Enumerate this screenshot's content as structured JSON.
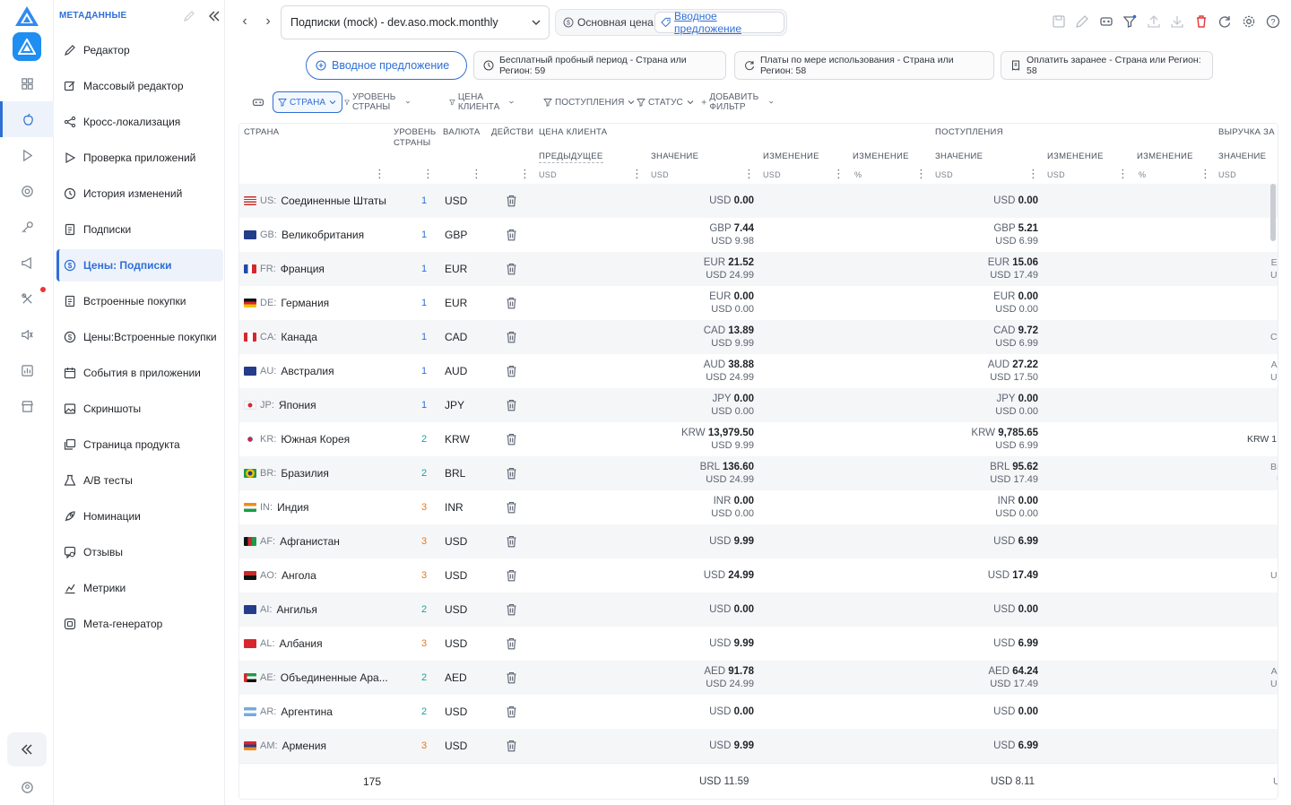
{
  "sidebar": {
    "title": "МЕТАДАННЫЕ",
    "items": [
      {
        "label": "Редактор",
        "icon": "pencil-icon"
      },
      {
        "label": "Массовый редактор",
        "icon": "edit-square-icon"
      },
      {
        "label": "Кросс-локализация",
        "icon": "share-icon"
      },
      {
        "label": "Проверка приложений",
        "icon": "play-icon"
      },
      {
        "label": "История изменений",
        "icon": "history-icon"
      },
      {
        "label": "Подписки",
        "icon": "document-icon"
      },
      {
        "label": "Цены: Подписки",
        "icon": "dollar-icon",
        "active": true
      },
      {
        "label": "Встроенные покупки",
        "icon": "document-icon"
      },
      {
        "label": "Цены:Встроенные покупки",
        "icon": "dollar-icon"
      },
      {
        "label": "События в приложении",
        "icon": "calendar-icon"
      },
      {
        "label": "Скриншоты",
        "icon": "image-icon"
      },
      {
        "label": "Страница продукта",
        "icon": "images-icon"
      },
      {
        "label": "A/B тесты",
        "icon": "flask-icon"
      },
      {
        "label": "Номинации",
        "icon": "rocket-icon"
      },
      {
        "label": "Отзывы",
        "icon": "review-icon"
      },
      {
        "label": "Метрики",
        "icon": "chart-icon"
      },
      {
        "label": "Мета-генератор",
        "icon": "generator-icon"
      }
    ]
  },
  "topbar": {
    "product_select": "Подписки (mock) - dev.aso.mock.monthly",
    "segment_base": "Основная цена",
    "segment_intro": "Вводное предложение"
  },
  "offers": {
    "intro": "Вводное предложение",
    "free_trial": "Бесплатный пробный период - Страна или Регион: 59",
    "pay_as_you_go": "Платы по мере использования - Страна или Регион: 58",
    "pay_up_front": "Оплатить заранее - Страна или Регион: 58"
  },
  "filters": {
    "country": "СТРАНА",
    "tier": "УРОВЕНЬ СТРАНЫ",
    "customer_price": "ЦЕНА КЛИЕНТА",
    "proceeds": "ПОСТУПЛЕНИЯ",
    "status": "СТАТУС",
    "add": "ДОБАВИТЬ ФИЛЬТР"
  },
  "table": {
    "headers": {
      "country": "СТРАНА",
      "tier_1": "УРОВЕНЬ",
      "tier_2": "СТРАНЫ",
      "currency": "ВАЛЮТА",
      "actions": "ДЕЙСТВИ",
      "customer_price": "ЦЕНА КЛИЕНТА",
      "previous": "ПРЕДЫДУЩЕЕ",
      "value": "ЗНАЧЕНИЕ",
      "change": "ИЗМЕНЕНИЕ",
      "change_pct": "ИЗМЕНЕНИЕ",
      "proceeds": "ПОСТУПЛЕНИЯ",
      "p_value": "ЗНАЧЕНИЕ",
      "p_change": "ИЗМЕНЕНИЕ",
      "p_change_pct": "ИЗМЕНЕНИЕ",
      "revenue": "ВЫРУЧКА ЗА",
      "r_value": "ЗНАЧЕНИЕ",
      "unit_usd": "USD",
      "unit_pct": "%"
    },
    "rows": [
      {
        "cc": "US:",
        "name": "Соединенные Штаты",
        "tier": "1",
        "cur": "USD",
        "price_cur": "USD",
        "price": "0.00",
        "price_usd": "",
        "proc_cur": "USD",
        "proc": "0.00",
        "proc_usd": "",
        "edge1": "",
        "edge2": "",
        "flag": "us"
      },
      {
        "cc": "GB:",
        "name": "Великобритания",
        "tier": "1",
        "cur": "GBP",
        "price_cur": "GBP",
        "price": "7.44",
        "price_usd": "USD 9.98",
        "proc_cur": "GBP",
        "proc": "5.21",
        "proc_usd": "USD 6.99",
        "edge1": "",
        "edge2": "",
        "flag": "gb"
      },
      {
        "cc": "FR:",
        "name": "Франция",
        "tier": "1",
        "cur": "EUR",
        "price_cur": "EUR",
        "price": "21.52",
        "price_usd": "USD 24.99",
        "proc_cur": "EUR",
        "proc": "15.06",
        "proc_usd": "USD 17.49",
        "edge1": "E",
        "edge2": "U",
        "flag": "fr"
      },
      {
        "cc": "DE:",
        "name": "Германия",
        "tier": "1",
        "cur": "EUR",
        "price_cur": "EUR",
        "price": "0.00",
        "price_usd": "USD 0.00",
        "proc_cur": "EUR",
        "proc": "0.00",
        "proc_usd": "USD 0.00",
        "edge1": "",
        "edge2": "",
        "flag": "de"
      },
      {
        "cc": "CA:",
        "name": "Канада",
        "tier": "1",
        "cur": "CAD",
        "price_cur": "CAD",
        "price": "13.89",
        "price_usd": "USD 9.99",
        "proc_cur": "CAD",
        "proc": "9.72",
        "proc_usd": "USD 6.99",
        "edge1": "C",
        "edge2": "",
        "flag": "ca"
      },
      {
        "cc": "AU:",
        "name": "Австралия",
        "tier": "1",
        "cur": "AUD",
        "price_cur": "AUD",
        "price": "38.88",
        "price_usd": "USD 24.99",
        "proc_cur": "AUD",
        "proc": "27.22",
        "proc_usd": "USD 17.50",
        "edge1": "A",
        "edge2": "U",
        "flag": "au"
      },
      {
        "cc": "JP:",
        "name": "Япония",
        "tier": "1",
        "cur": "JPY",
        "price_cur": "JPY",
        "price": "0.00",
        "price_usd": "USD 0.00",
        "proc_cur": "JPY",
        "proc": "0.00",
        "proc_usd": "USD 0.00",
        "edge1": "",
        "edge2": "",
        "flag": "jp"
      },
      {
        "cc": "KR:",
        "name": "Южная Корея",
        "tier": "2",
        "cur": "KRW",
        "price_cur": "KRW",
        "price": "13,979.50",
        "price_usd": "USD 9.99",
        "proc_cur": "KRW",
        "proc": "9,785.65",
        "proc_usd": "USD 6.99",
        "edge1": "KRW 1",
        "edge2": "",
        "flag": "kr"
      },
      {
        "cc": "BR:",
        "name": "Бразилия",
        "tier": "2",
        "cur": "BRL",
        "price_cur": "BRL",
        "price": "136.60",
        "price_usd": "USD 24.99",
        "proc_cur": "BRL",
        "proc": "95.62",
        "proc_usd": "USD 17.49",
        "edge1": "BR",
        "edge2": "U",
        "flag": "br"
      },
      {
        "cc": "IN:",
        "name": "Индия",
        "tier": "3",
        "cur": "INR",
        "price_cur": "INR",
        "price": "0.00",
        "price_usd": "USD 0.00",
        "proc_cur": "INR",
        "proc": "0.00",
        "proc_usd": "USD 0.00",
        "edge1": "",
        "edge2": "",
        "flag": "in"
      },
      {
        "cc": "AF:",
        "name": "Афганистан",
        "tier": "3",
        "cur": "USD",
        "price_cur": "USD",
        "price": "9.99",
        "price_usd": "",
        "proc_cur": "USD",
        "proc": "6.99",
        "proc_usd": "",
        "edge1": "",
        "edge2": "",
        "flag": "af"
      },
      {
        "cc": "AO:",
        "name": "Ангола",
        "tier": "3",
        "cur": "USD",
        "price_cur": "USD",
        "price": "24.99",
        "price_usd": "",
        "proc_cur": "USD",
        "proc": "17.49",
        "proc_usd": "",
        "edge1": "U",
        "edge2": "",
        "flag": "ao"
      },
      {
        "cc": "AI:",
        "name": "Ангилья",
        "tier": "2",
        "cur": "USD",
        "price_cur": "USD",
        "price": "0.00",
        "price_usd": "",
        "proc_cur": "USD",
        "proc": "0.00",
        "proc_usd": "",
        "edge1": "",
        "edge2": "",
        "flag": "ai"
      },
      {
        "cc": "AL:",
        "name": "Албания",
        "tier": "3",
        "cur": "USD",
        "price_cur": "USD",
        "price": "9.99",
        "price_usd": "",
        "proc_cur": "USD",
        "proc": "6.99",
        "proc_usd": "",
        "edge1": "",
        "edge2": "",
        "flag": "al"
      },
      {
        "cc": "AE:",
        "name": "Объединенные Ара...",
        "tier": "2",
        "cur": "AED",
        "price_cur": "AED",
        "price": "91.78",
        "price_usd": "USD 24.99",
        "proc_cur": "AED",
        "proc": "64.24",
        "proc_usd": "USD 17.49",
        "edge1": "A",
        "edge2": "U",
        "flag": "ae"
      },
      {
        "cc": "AR:",
        "name": "Аргентина",
        "tier": "2",
        "cur": "USD",
        "price_cur": "USD",
        "price": "0.00",
        "price_usd": "",
        "proc_cur": "USD",
        "proc": "0.00",
        "proc_usd": "",
        "edge1": "",
        "edge2": "",
        "flag": "ar"
      },
      {
        "cc": "AM:",
        "name": "Армения",
        "tier": "3",
        "cur": "USD",
        "price_cur": "USD",
        "price": "9.99",
        "price_usd": "",
        "proc_cur": "USD",
        "proc": "6.99",
        "proc_usd": "",
        "edge1": "",
        "edge2": "",
        "flag": "am"
      }
    ],
    "footer": {
      "count": "175",
      "price_avg": "USD 11.59",
      "proceeds_avg": "USD 8.11",
      "edge": "U"
    }
  },
  "colors": {
    "accent": "#2f6fd6",
    "danger": "#e33b3b",
    "tier1": "#2f6fd6",
    "tier2": "#1aa39a",
    "tier3": "#e07a1f"
  }
}
